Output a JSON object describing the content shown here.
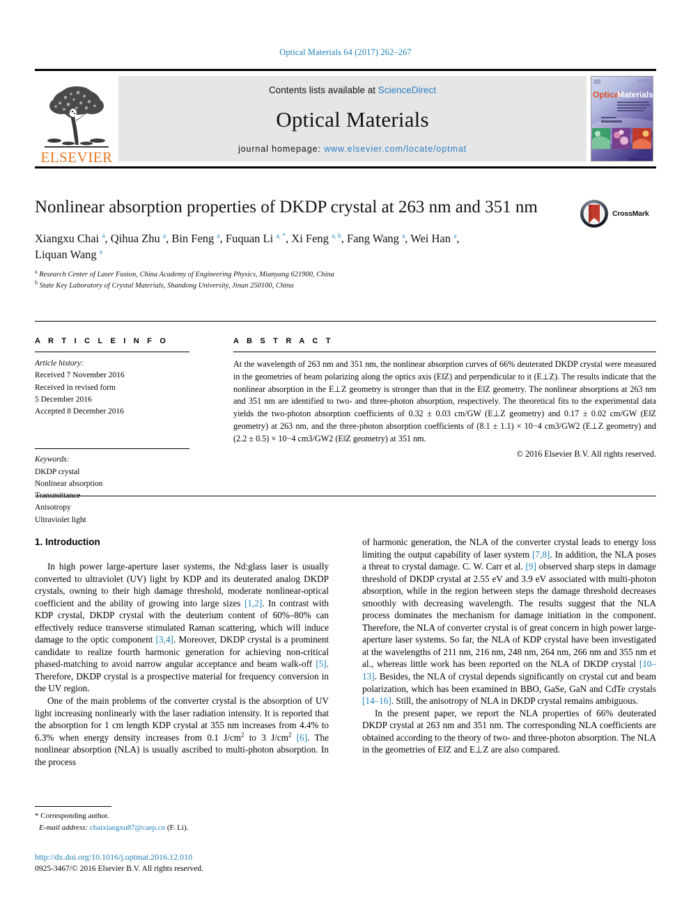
{
  "running_head": "Optical Materials 64 (2017) 262–267",
  "masthead": {
    "publisher_name": "ELSEVIER",
    "contents_prefix": "Contents lists available at ",
    "contents_link": "ScienceDirect",
    "journal_name": "Optical Materials",
    "homepage_prefix": "journal homepage: ",
    "homepage_link": "www.elsevier.com/locate/optmat",
    "cover_title_part1": "Optical",
    "cover_title_part2": "Materials"
  },
  "title": "Nonlinear absorption properties of DKDP crystal at 263 nm and 351 nm",
  "crossmark_label": "CrossMark",
  "authors_line1": "Xiangxu Chai a, Qihua Zhu a, Bin Feng a, Fuquan Li a, *, Xi Feng a, b, Fang Wang a, Wei Han a,",
  "authors_line2": "Liquan Wang a",
  "affiliations": [
    {
      "mark": "a",
      "text": "Research Center of Laser Fusion, China Academy of Engineering Physics, Mianyang 621900, China"
    },
    {
      "mark": "b",
      "text": "State Key Laboratory of Crystal Materials, Shandong University, Jinan 250100, China"
    }
  ],
  "article_info": {
    "heading": "A R T I C L E  I N F O",
    "history_label": "Article history:",
    "history": [
      "Received 7 November 2016",
      "Received in revised form",
      "5 December 2016",
      "Accepted 8 December 2016"
    ],
    "keywords_label": "Keywords:",
    "keywords": [
      "DKDP crystal",
      "Nonlinear absorption",
      "Transmittance",
      "Anisotropy",
      "Ultraviolet light"
    ]
  },
  "abstract": {
    "heading": "A B S T R A C T",
    "text": "At the wavelength of 263 nm and 351 nm, the nonlinear absorption curves of 66% deuterated DKDP crystal were measured in the geometries of beam polarizing along the optics axis (E‖Z) and perpendicular to it (E⊥Z). The results indicate that the nonlinear absorption in the E⊥Z geometry is stronger than that in the E‖Z geometry. The nonlinear absorptions at 263 nm and 351 nm are identified to two- and three-photon absorption, respectively. The theoretical fits to the experimental data yields the two-photon absorption coefficients of 0.32 ± 0.03 cm/GW (E⊥Z geometry) and 0.17 ± 0.02 cm/GW (E‖Z geometry) at 263 nm, and the three-photon absorption coefficients of (8.1 ± 1.1) × 10−4 cm3/GW2 (E⊥Z geometry) and (2.2 ± 0.5) × 10−4 cm3/GW2 (E‖Z geometry) at 351 nm.",
    "copyright": "© 2016 Elsevier B.V. All rights reserved."
  },
  "section_title": "1.  Introduction",
  "body": {
    "left_p1_a": "In high power large-aperture laser systems, the Nd:glass laser is usually converted to ultraviolet (UV) light by KDP and its deuterated analog DKDP crystals, owning to their high damage threshold, moderate nonlinear-optical coefficient and the ability of growing into large sizes ",
    "left_p1_cite1": "[1,2]",
    "left_p1_b": ". In contrast with KDP crystal, DKDP crystal with the deuterium content of 60%–80% can effectively reduce transverse stimulated Raman scattering, which will induce damage to the optic component ",
    "left_p1_cite2": "[3,4]",
    "left_p1_c": ". Moreover, DKDP crystal is a prominent candidate to realize fourth harmonic generation for achieving non-critical phased-matching to avoid narrow angular acceptance and beam walk-off ",
    "left_p1_cite3": "[5]",
    "left_p1_d": ". Therefore, DKDP crystal is a prospective material for frequency conversion in the UV region.",
    "left_p2_a": "One of the main problems of the converter crystal is the absorption of UV light increasing nonlinearly with the laser radiation intensity. It is reported that the absorption for 1 cm length KDP crystal at 355 nm increases from 4.4% to 6.3% when energy density increases from 0.1 J/cm",
    "left_p2_sup1": "2",
    "left_p2_b": " to 3 J/cm",
    "left_p2_sup2": "2",
    "left_p2_c": " ",
    "left_p2_cite1": "[6]",
    "left_p2_d": ". The nonlinear absorption (NLA) is usually ascribed to multi-photon absorption. In the process",
    "right_p1_a": "of harmonic generation, the NLA of the converter crystal leads to energy loss limiting the output capability of laser system ",
    "right_p1_cite1": "[7,8]",
    "right_p1_b": ". In addition, the NLA poses a threat to crystal damage. C. W. Carr et al. ",
    "right_p1_cite2": "[9]",
    "right_p1_c": " observed sharp steps in damage threshold of DKDP crystal at 2.55 eV and 3.9 eV associated with multi-photon absorption, while in the region between steps the damage threshold decreases smoothly with decreasing wavelength. The results suggest that the NLA process dominates the mechanism for damage initiation in the component. Therefore, the NLA of converter crystal is of great concern in high power large-aperture laser systems. So far, the NLA of KDP crystal have been investigated at the wavelengths of 211 nm, 216 nm, 248 nm, 264 nm, 266 nm and 355 nm et al., whereas little work has been reported on the NLA of DKDP crystal ",
    "right_p1_cite3": "[10–13]",
    "right_p1_d": ". Besides, the NLA of crystal depends significantly on crystal cut and beam polarization, which has been examined in BBO, GaSe, GaN and CdTe crystals ",
    "right_p1_cite4": "[14–16]",
    "right_p1_e": ". Still, the anisotropy of NLA in DKDP crystal remains ambiguous.",
    "right_p2": "In the present paper, we report the NLA properties of 66% deuterated DKDP crystal at 263 nm and 351 nm. The corresponding NLA coefficients are obtained according to the theory of two- and three-photon absorption. The NLA in the geometries of E‖Z and E⊥Z are also compared."
  },
  "footnote": {
    "corresponding": "* Corresponding author.",
    "email_label": "E-mail address: ",
    "email": "chaixiangxu87@caep.cn",
    "email_suffix": " (F. Li)."
  },
  "doi": "http://dx.doi.org/10.1016/j.optmat.2016.12.010",
  "issn_line": "0925-3467/© 2016 Elsevier B.V. All rights reserved."
}
